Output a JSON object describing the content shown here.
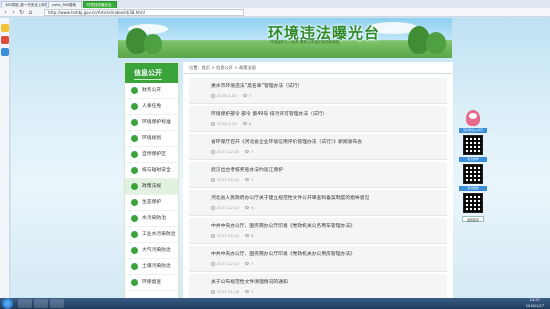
{
  "browser": {
    "tabs": [
      "360导航_新一代安全上网导航",
      "yoho_360搜索",
      "环境违法曝光台"
    ],
    "url": "http://www.hnhbj.gov.cn/Article/index/id/38.html"
  },
  "site": {
    "banner_title": "环境违法曝光台",
    "banner_subtitle": "环境保护人人有责 履职尽责保护美丽新家园",
    "sidebar": {
      "title": "信息公开",
      "items": [
        "财务公开",
        "人事任免",
        "环境保护标准",
        "环境规划",
        "自然保护区",
        "核与辐射安全",
        "政策法规",
        "生态保护",
        "水污染防治",
        "工业水污染防治",
        "大气污染防治",
        "土壤污染防治",
        "环保督查"
      ],
      "active_index": 6
    },
    "breadcrumb": "位置：首页 > 信息公开 > 政策法规",
    "news": [
      {
        "title": "惠水市环境违法“黑名单”管理办法（试行）",
        "date": "2018-1-24",
        "views": "7"
      },
      {
        "title": "环境保护部令 部令 第49号 排污许可管理办法（试行）",
        "date": "2018-1-10",
        "views": "8"
      },
      {
        "title": "省环保厅召开《河北省企业环境信用评价管理办法（试行）》新闻发布会",
        "date": "2017-12-20",
        "views": "7"
      },
      {
        "title": "武汉出台考核奖惩办法约谈江保护",
        "date": "2017-12-12",
        "views": "7"
      },
      {
        "title": "河北省人民政府办公厅关于建立规范性文件公开审查和备案制度的指导意见",
        "date": "2017-12-12",
        "views": "6"
      },
      {
        "title": "中共中央办公厅、国务院办公厅印发《党政机关公务用车管理办法》",
        "date": "2017-12-12",
        "views": "8"
      },
      {
        "title": "中共中央办公厅、国务院办公厅印发《党政机关办公用房管理办法》",
        "date": "2017-12-12",
        "views": "7"
      },
      {
        "title": "关于公布规范性文件清理情况的通知",
        "date": "2017-11-28",
        "views": "7"
      }
    ],
    "right_float": {
      "labels": [
        "官方微信公众号",
        "官方微博",
        "官方微博"
      ],
      "back_home": "返回首页"
    }
  },
  "taskbar": {
    "time": "14:57",
    "date": "2018/1/27"
  },
  "colors": {
    "green": "#3aa43a",
    "banner_text": "#2f8a2a",
    "taskbar": "#1d3a5c"
  }
}
